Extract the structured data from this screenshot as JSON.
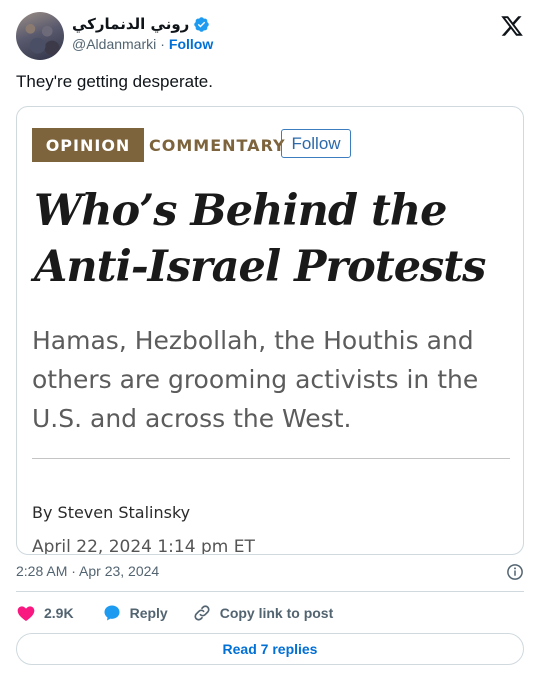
{
  "author": {
    "display_name": "روني الدنماركي",
    "handle": "@Aldanmarki",
    "separator": "·",
    "follow_label": "Follow",
    "avatar_icon": "profile-photo-avatar",
    "verified_icon": "verified-badge-icon",
    "verified_color": "#1d9bf0"
  },
  "platform_logo": "x-logo-icon",
  "tweet": {
    "text": "They're getting desperate."
  },
  "card": {
    "badge": "OPINION",
    "section": "COMMENTARY",
    "follow_label": "Follow",
    "headline": "Who’s Behind the Anti-Israel Protests",
    "dek": "Hamas, Hezbollah, the Houthis and others are grooming activists in the U.S. and across the West.",
    "byline": "By Steven Stalinsky",
    "dateline": "April 22, 2024 1:14 pm ET",
    "badge_color": "#7d643c",
    "follow_color": "#2c6aab"
  },
  "meta": {
    "timestamp": "2:28 AM · Apr 23, 2024",
    "info_icon": "info-icon"
  },
  "actions": {
    "like_count": "2.9K",
    "reply_label": "Reply",
    "copy_label": "Copy link to post",
    "like_color": "#f91880",
    "reply_color": "#1d9bf0"
  },
  "read_replies_label": "Read 7 replies"
}
